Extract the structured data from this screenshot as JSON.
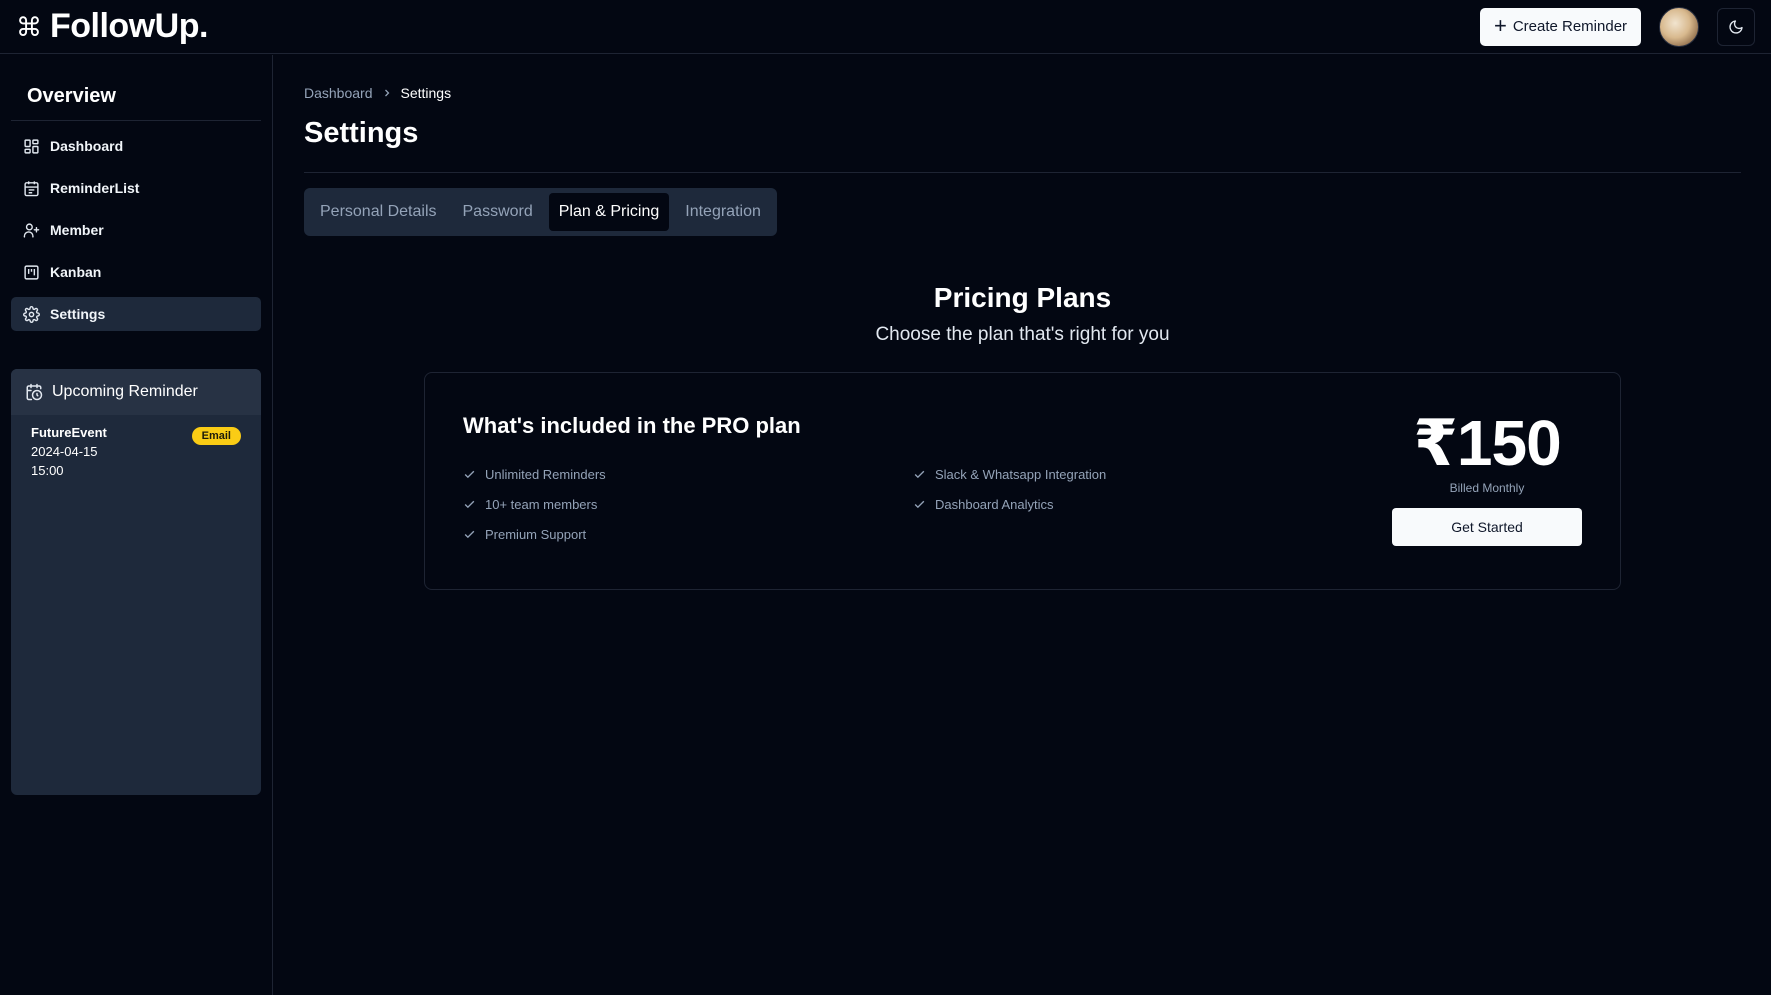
{
  "brand": {
    "name": "FollowUp.",
    "icon": "command-icon"
  },
  "header": {
    "create_label": "Create Reminder"
  },
  "sidebar": {
    "title": "Overview",
    "items": [
      {
        "label": "Dashboard",
        "icon": "dashboard-icon",
        "active": false
      },
      {
        "label": "ReminderList",
        "icon": "calendar-icon",
        "active": false
      },
      {
        "label": "Member",
        "icon": "user-plus-icon",
        "active": false
      },
      {
        "label": "Kanban",
        "icon": "kanban-icon",
        "active": false
      },
      {
        "label": "Settings",
        "icon": "gear-icon",
        "active": true
      }
    ]
  },
  "upcoming": {
    "title": "Upcoming Reminder",
    "event": {
      "name": "FutureEvent",
      "date": "2024-04-15",
      "time": "15:00",
      "badge": "Email"
    }
  },
  "main": {
    "breadcrumb": [
      "Dashboard",
      "Settings"
    ],
    "title": "Settings",
    "tabs": [
      {
        "label": "Personal Details",
        "active": false
      },
      {
        "label": "Password",
        "active": false
      },
      {
        "label": "Plan & Pricing",
        "active": true
      },
      {
        "label": "Integration",
        "active": false
      }
    ],
    "pricing": {
      "title": "Pricing Plans",
      "subtitle": "Choose the plan that's right for you",
      "plan_title": "What's included in the PRO plan",
      "features": [
        "Unlimited Reminders",
        "Slack & Whatsapp Integration",
        "10+ team members",
        "Dashboard Analytics",
        "Premium Support"
      ],
      "price": "₹150",
      "billing": "Billed Monthly",
      "cta": "Get Started"
    }
  },
  "colors": {
    "background": "#030712",
    "panel": "#1e293b",
    "accent_badge": "#facc15"
  }
}
